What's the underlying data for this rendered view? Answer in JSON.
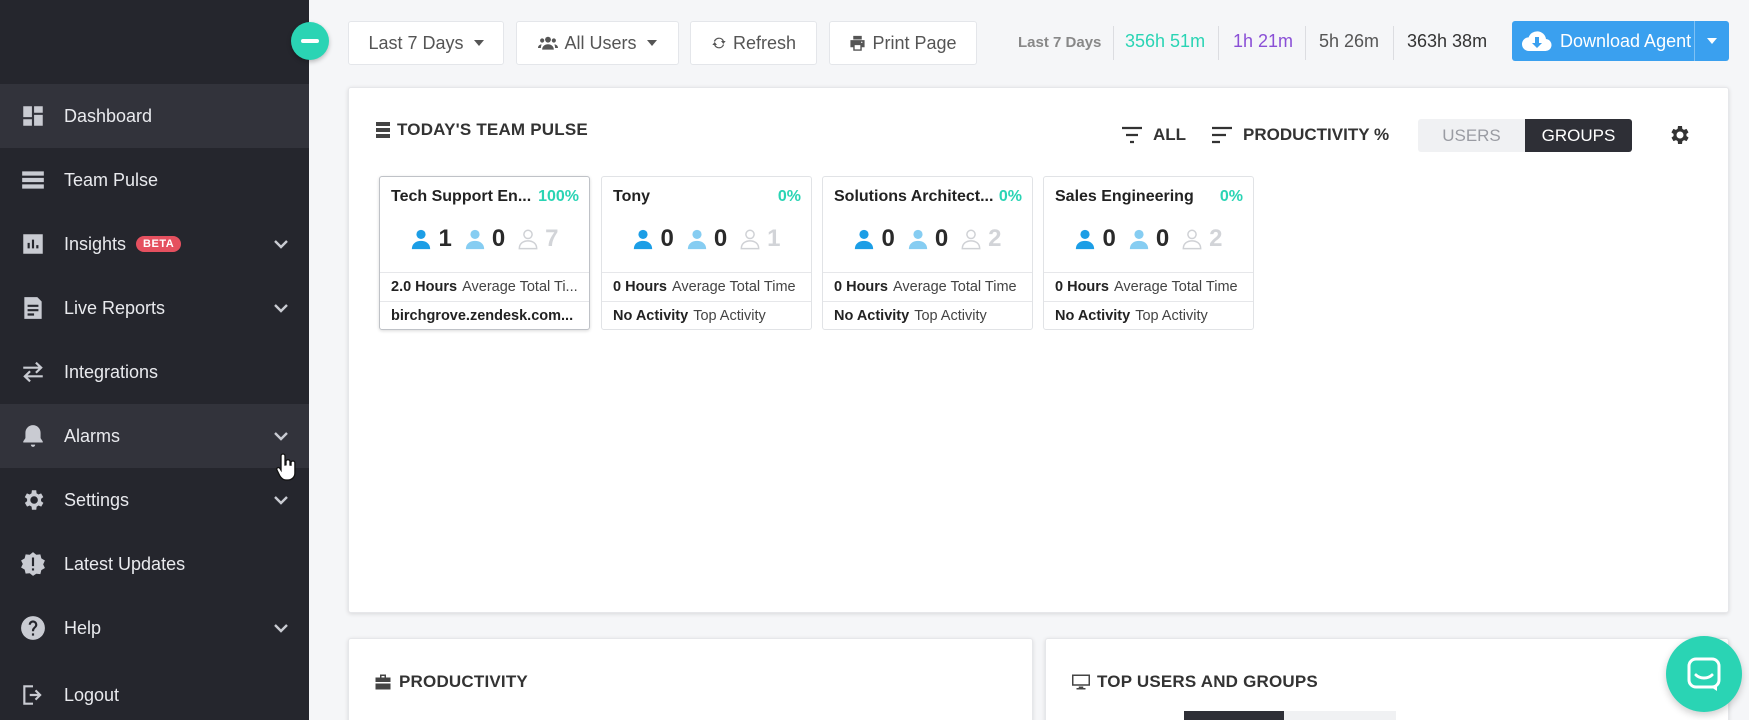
{
  "sidebar": {
    "items": [
      {
        "label": "Dashboard",
        "icon": "dashboard-icon"
      },
      {
        "label": "Team Pulse",
        "icon": "team-pulse-icon"
      },
      {
        "label": "Insights",
        "icon": "insights-icon",
        "badge": "BETA"
      },
      {
        "label": "Live Reports",
        "icon": "live-reports-icon"
      },
      {
        "label": "Integrations",
        "icon": "integrations-icon"
      },
      {
        "label": "Alarms",
        "icon": "bell-icon"
      },
      {
        "label": "Settings",
        "icon": "gear-icon"
      },
      {
        "label": "Latest Updates",
        "icon": "alert-badge-icon"
      },
      {
        "label": "Help",
        "icon": "help-icon"
      },
      {
        "label": "Logout",
        "icon": "logout-icon"
      }
    ]
  },
  "toolbar": {
    "date_range": "Last 7 Days",
    "users_filter": "All Users",
    "refresh_label": "Refresh",
    "print_label": "Print Page",
    "stats_label": "Last 7 Days",
    "stat_total": "356h 51m",
    "stat_secondary": "1h 21m",
    "stat_third": "5h 26m",
    "stat_fourth": "363h 38m",
    "download_label": "Download Agent"
  },
  "colors": {
    "accent_teal": "#2ad4b4",
    "accent_purple": "#8a4fd6",
    "download_blue": "#3aa0ef",
    "sidebar_bg": "#25262d"
  },
  "team_pulse": {
    "title": "TODAY'S TEAM PULSE",
    "filter_all": "ALL",
    "sort_label": "PRODUCTIVITY %",
    "toggle_users": "USERS",
    "toggle_groups": "GROUPS",
    "cards": [
      {
        "name": "Tech Support En...",
        "pct": "100%",
        "active": "1",
        "idle": "0",
        "offline": "7",
        "hours": "2.0 Hours",
        "hours_label": "Average Total Ti...",
        "activity": "birchgrove.zendesk.com...",
        "activity_label": ""
      },
      {
        "name": "Tony",
        "pct": "0%",
        "active": "0",
        "idle": "0",
        "offline": "1",
        "hours": "0 Hours",
        "hours_label": "Average Total Time",
        "activity": "No Activity",
        "activity_label": "Top Activity"
      },
      {
        "name": "Solutions Architect...",
        "pct": "0%",
        "active": "0",
        "idle": "0",
        "offline": "2",
        "hours": "0 Hours",
        "hours_label": "Average Total Time",
        "activity": "No Activity",
        "activity_label": "Top Activity"
      },
      {
        "name": "Sales Engineering",
        "pct": "0%",
        "active": "0",
        "idle": "0",
        "offline": "2",
        "hours": "0 Hours",
        "hours_label": "Average Total Time",
        "activity": "No Activity",
        "activity_label": "Top Activity"
      }
    ]
  },
  "productivity": {
    "title": "PRODUCTIVITY"
  },
  "top_users": {
    "title": "TOP USERS AND GROUPS"
  }
}
